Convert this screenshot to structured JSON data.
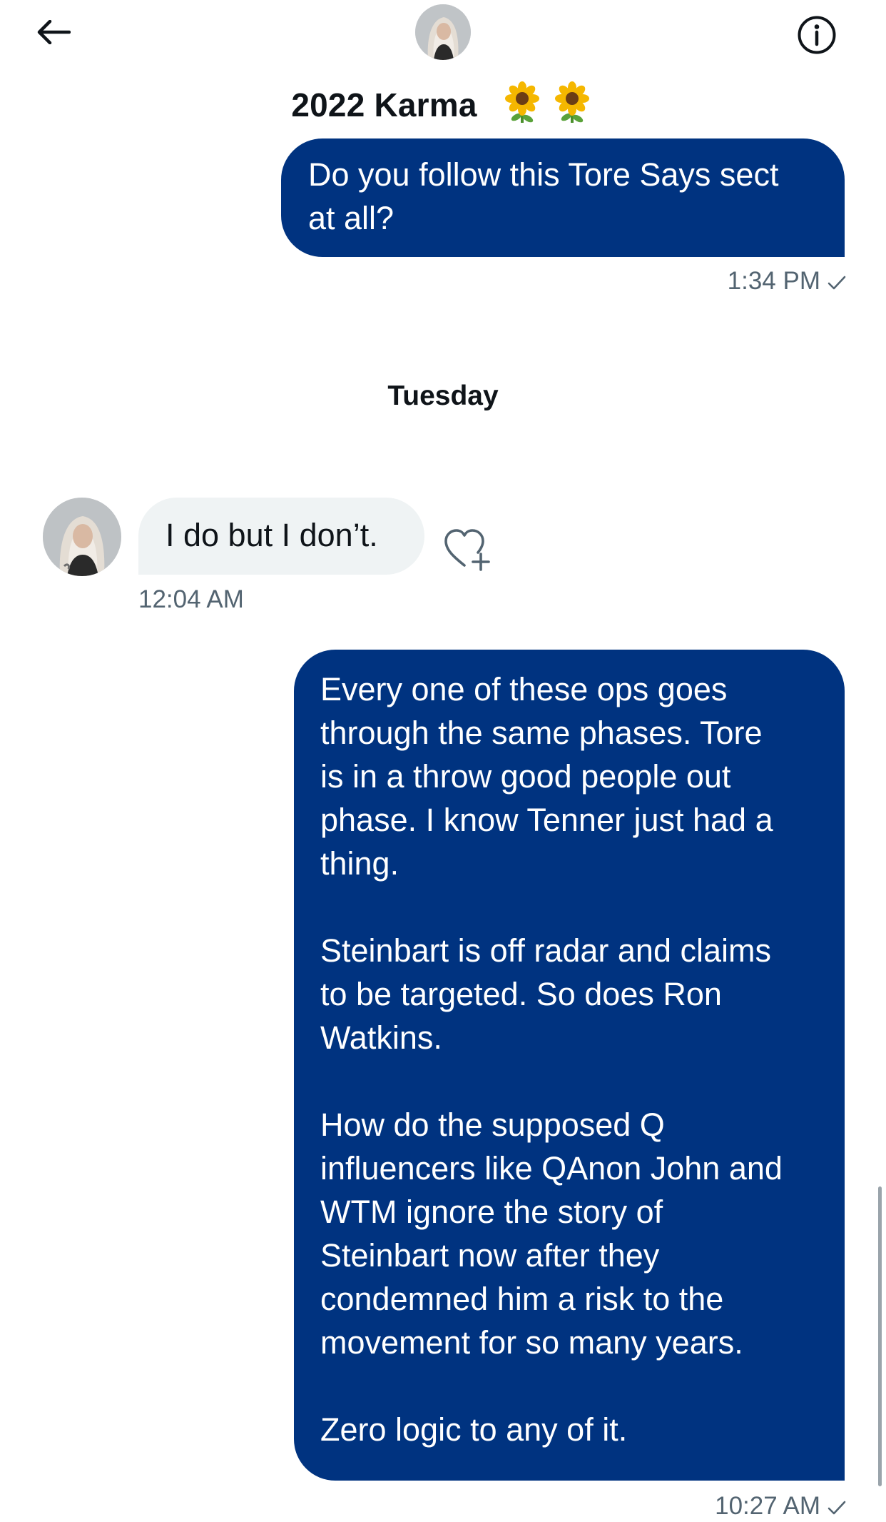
{
  "header": {
    "contact_name": "2022 Karma",
    "name_emoji": "🌻 🌻",
    "back_icon": "arrow-left-icon",
    "info_icon": "info-circle-icon"
  },
  "messages": [
    {
      "direction": "sent",
      "text": "Do you follow this Tore Says sect\nat all?",
      "time": "1:34 PM",
      "status_icon": "check-icon"
    },
    {
      "direction": "received",
      "text": "I do but I don’t.",
      "time": "12:04 AM",
      "reaction_icon": "heart-plus-icon"
    },
    {
      "direction": "sent",
      "text": "Every one of these ops goes\nthrough the same phases. Tore\nis in a throw good people out\nphase. I know Tenner just had a\nthing.\n\nSteinbart is off radar and claims\nto be targeted. So does Ron\nWatkins.\n\nHow do the supposed Q\ninfluencers like QAnon John and\nWTM ignore the story of\nSteinbart now after they\ncondemned him a risk to the\nmovement for so many years.\n\nZero logic to any of it.",
      "time": "10:27 AM",
      "status_icon": "check-icon"
    }
  ],
  "date_separator": "Tuesday",
  "colors": {
    "sent_bubble": "#003380",
    "received_bubble": "#eff3f4",
    "timestamp": "#536471",
    "text": "#0f1419"
  }
}
